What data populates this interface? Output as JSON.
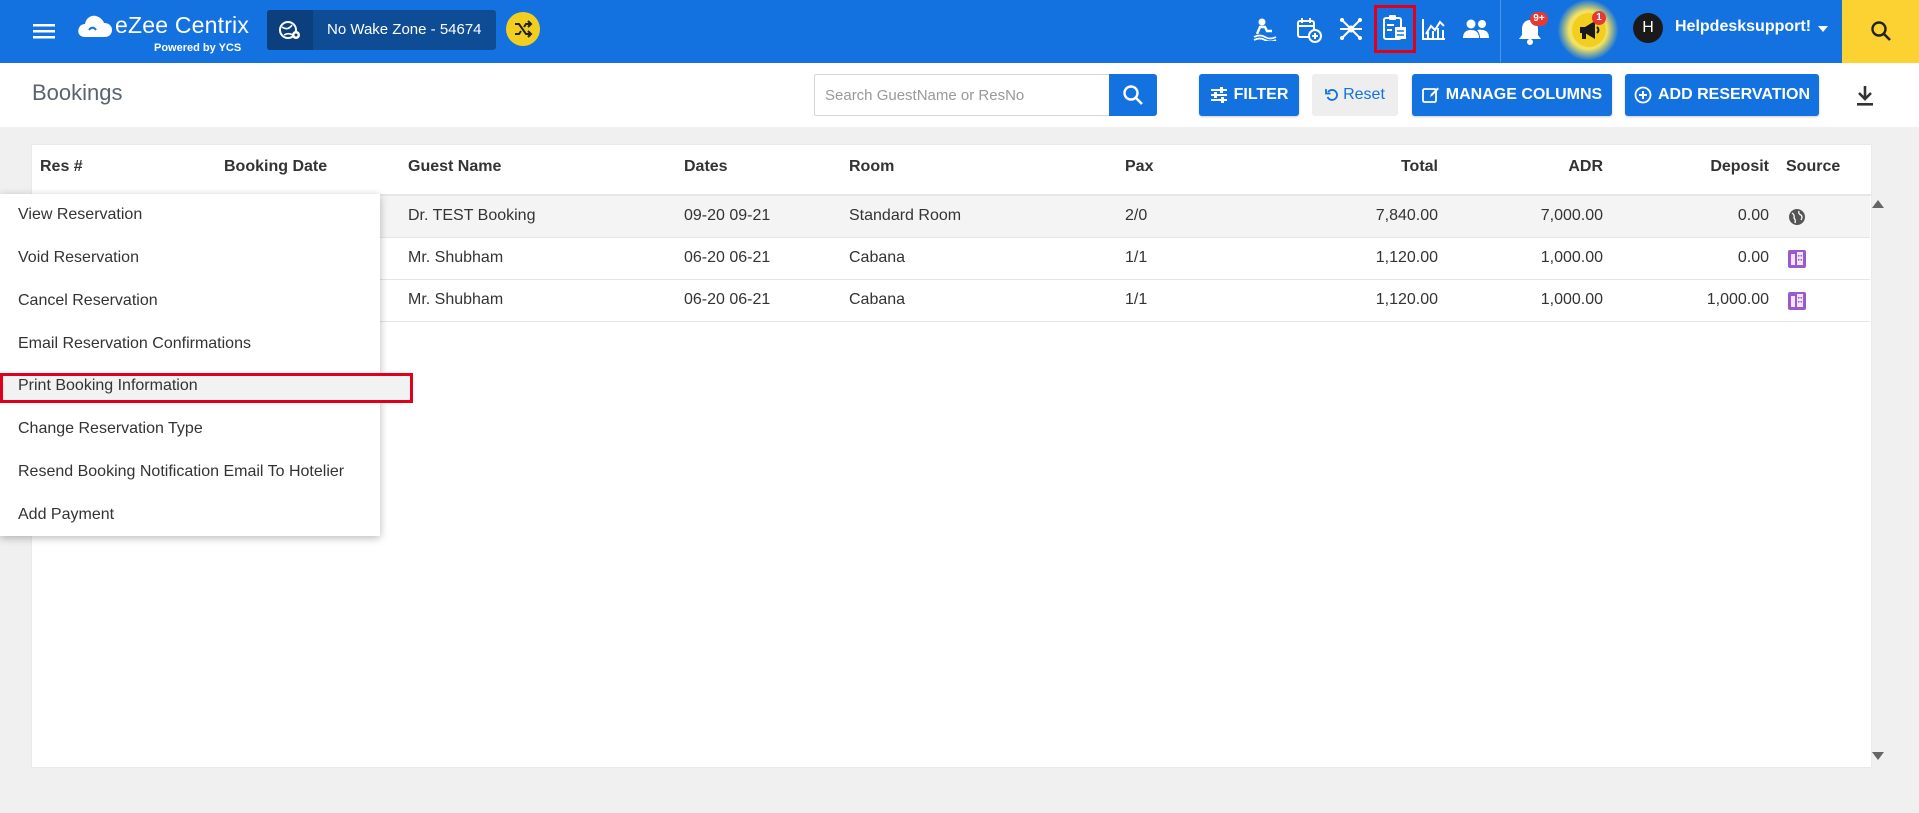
{
  "app": {
    "brand": "eZee Centrix",
    "powered_by": "Powered by YCS",
    "hotel_name": "No Wake Zone -  54674",
    "user_initial": "H",
    "user_name": "Helpdesksupport!",
    "notifications_badge": "9+",
    "announcements_badge": "1",
    "accent_color": "#1372e0",
    "yellow_color": "#fcd232",
    "highlight_color": "#e0001a",
    "toolbar_icons": [
      "hotel-guest-icon",
      "calendar-add-icon",
      "channel-network-icon",
      "clipboard-reports-icon",
      "analytics-chart-icon",
      "users-icon"
    ]
  },
  "page": {
    "title": "Bookings",
    "search_placeholder": "Search GuestName or ResNo",
    "filter_label": "FILTER",
    "reset_label": "Reset",
    "manage_columns_label": "MANAGE COLUMNS",
    "add_reservation_label": "ADD RESERVATION"
  },
  "table": {
    "headers": {
      "res": "Res #",
      "booking_date": "Booking Date",
      "guest_name": "Guest Name",
      "dates": "Dates",
      "room": "Room",
      "pax": "Pax",
      "total": "Total",
      "adr": "ADR",
      "deposit": "Deposit",
      "source": "Source"
    },
    "rows": [
      {
        "guest": "Dr. TEST Booking",
        "dates": "09-20 09-21",
        "room": "Standard Room",
        "pax": "2/0",
        "total": "7,840.00",
        "adr": "7,000.00",
        "deposit": "0.00",
        "source_icon": "globe-icon"
      },
      {
        "guest": "Mr. Shubham",
        "dates": "06-20 06-21",
        "room": "Cabana",
        "pax": "1/1",
        "total": "1,120.00",
        "adr": "1,000.00",
        "deposit": "0.00",
        "source_icon": "building-icon"
      },
      {
        "guest": "Mr. Shubham",
        "dates": "06-20 06-21",
        "room": "Cabana",
        "pax": "1/1",
        "total": "1,120.00",
        "adr": "1,000.00",
        "deposit": "1,000.00",
        "source_icon": "building-icon"
      }
    ]
  },
  "context_menu": {
    "items": [
      "View Reservation",
      "Void Reservation",
      "Cancel Reservation",
      "Email Reservation Confirmations",
      "Print Booking Information",
      "Change Reservation Type",
      "Resend Booking Notification Email To Hotelier",
      "Add Payment"
    ],
    "highlighted_item": "Print Booking Information"
  }
}
